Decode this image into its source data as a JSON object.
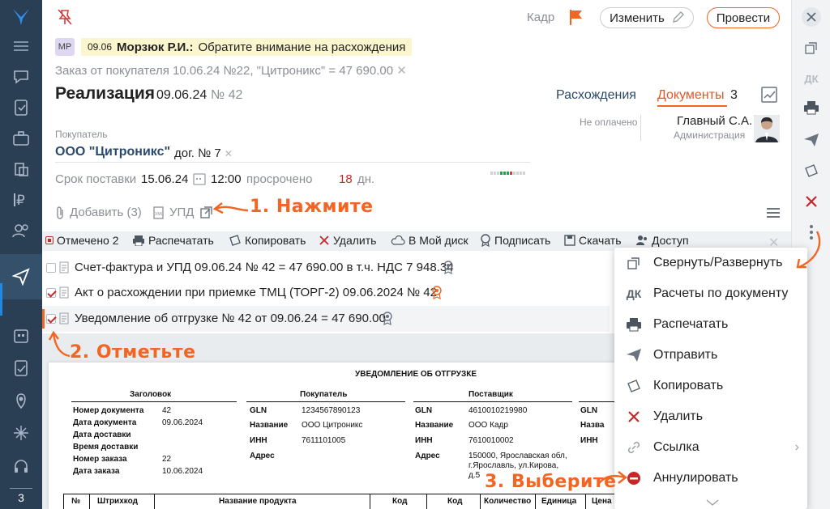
{
  "header": {
    "kadr_label": "Кадр",
    "edit_button": "Изменить",
    "post_button": "Провести"
  },
  "notice": {
    "avatar": "МР",
    "date": "09.06",
    "author": "Морзюк Р.И.:",
    "text": "Обратите внимание на расхождения"
  },
  "order_link": "Заказ от покупателя 10.06.24 №22, \"Цитроникс\" = 47 690.00",
  "document": {
    "title": "Реализация",
    "date": "09.06.24",
    "number": "№ 42",
    "tab_discrepancies": "Расхождения",
    "tab_documents": "Документы",
    "documents_count": "3",
    "payment_status": "Не оплачено",
    "responsible_name": "Главный С.А.",
    "responsible_role": "Администрация",
    "buyer_label": "Покупатель",
    "buyer_name": "ООО \"Цитроникс\"",
    "contract": "дог. № 7",
    "delivery_label": "Срок поставки",
    "delivery_date": "15.06.24",
    "delivery_time": "12:00",
    "overdue_label": "просрочено",
    "overdue_days": "18",
    "days_unit": "дн."
  },
  "actions": {
    "add": "Добавить (3)",
    "upd": "УПД"
  },
  "toolbar": {
    "marked": "Отмечено 2",
    "print": "Распечатать",
    "copy": "Копировать",
    "delete": "Удалить",
    "disk": "В Мой диск",
    "sign": "Подписать",
    "download": "Скачать",
    "access": "Доступ"
  },
  "attached_docs": [
    {
      "title": "Счет-фактура и УПД 09.06.24 № 42 = 47 690.00 в т.ч. НДС 7 948.34",
      "checked": false
    },
    {
      "title": "Акт о расхождении при приемке ТМЦ (ТОРГ-2) 09.06.2024 № 42",
      "checked": true
    },
    {
      "title": "Уведомление об отгрузке № 42 от 09.06.24 = 47 690.00",
      "checked": true
    }
  ],
  "menu": {
    "items": [
      {
        "label": "Свернуть/Развернуть",
        "icon": "collapse-icon"
      },
      {
        "label": "Расчеты по документу",
        "icon": "dk-icon"
      },
      {
        "label": "Распечатать",
        "icon": "printer-icon"
      },
      {
        "label": "Отправить",
        "icon": "send-icon"
      },
      {
        "label": "Копировать",
        "icon": "copy-icon"
      },
      {
        "label": "Удалить",
        "icon": "delete-icon"
      },
      {
        "label": "Ссылка",
        "icon": "link-icon"
      },
      {
        "label": "Аннулировать",
        "icon": "cancel-icon"
      }
    ]
  },
  "right_toolbar": {
    "dk": "ДК"
  },
  "left_nav": {
    "counter": "3"
  },
  "preview": {
    "title": "УВЕДОМЛЕНИЕ ОБ ОТГРУЗКЕ",
    "header_section": "Заголовок",
    "buyer_section": "Покупатель",
    "supplier_section": "Поставщик",
    "fields": {
      "doc_number_label": "Номер документа",
      "doc_number": "42",
      "doc_date_label": "Дата документа",
      "doc_date": "09.06.2024",
      "delivery_date_label": "Дата доставки",
      "delivery_time_label": "Время доставки",
      "order_number_label": "Номер заказа",
      "order_number": "22",
      "order_date_label": "Дата заказа",
      "order_date": "10.06.2024"
    },
    "buyer": {
      "gln_label": "GLN",
      "gln": "1234567890123",
      "name_label": "Название",
      "name": "ООО Цитроникс",
      "inn_label": "ИНН",
      "inn": "7611101005",
      "address_label": "Адрес"
    },
    "supplier": {
      "gln_label": "GLN",
      "gln": "4610010219980",
      "name_label": "Название",
      "name": "ООО Кадр",
      "inn_label": "ИНН",
      "inn": "7610010002",
      "address_label": "Адрес",
      "address1": "150000, Ярославская обл,",
      "address2": "г.Ярославль, ул.Кирова,",
      "address3": "д.5"
    },
    "extra": {
      "gln_label": "GLN",
      "name_label": "Назва",
      "inn_label": "ИНН"
    },
    "table_headers": [
      "№",
      "Штрихкод",
      "Название продукта",
      "Код",
      "Код",
      "Количество",
      "Единица",
      "Цена"
    ]
  },
  "annotations": {
    "step1": "1. Нажмите",
    "step2": "2. Отметьте",
    "step3": "3. Выберите"
  },
  "colors": {
    "accent": "#f26522",
    "nav_bg": "#2a3e54",
    "danger": "#c62828"
  }
}
